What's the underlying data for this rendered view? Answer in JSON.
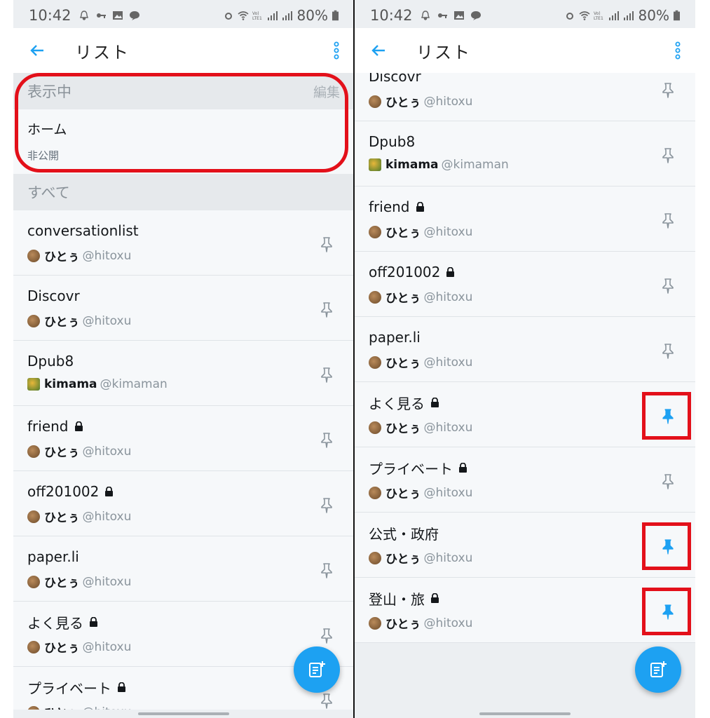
{
  "status": {
    "time": "10:42",
    "battery": "80%",
    "left_icons": [
      "notification-bell-icon",
      "key-icon",
      "image-icon",
      "chat-bubble-icon"
    ],
    "right_icons": [
      "alarm-icon",
      "wifi-icon",
      "volte-icon",
      "signal-icon",
      "signal-icon",
      "battery-icon"
    ]
  },
  "appbar": {
    "title": "リスト"
  },
  "left": {
    "visible_section": {
      "title": "表示中",
      "edit": "編集"
    },
    "home": {
      "name": "ホーム",
      "sub": "非公開"
    },
    "all_section": {
      "title": "すべて"
    },
    "lists": [
      {
        "name": "conversationlist",
        "locked": false,
        "owner": "ひとぅ",
        "handle": "@hitoxu",
        "pinned": false
      },
      {
        "name": "Discovr",
        "locked": false,
        "owner": "ひとぅ",
        "handle": "@hitoxu",
        "pinned": false
      },
      {
        "name": "Dpub8",
        "locked": false,
        "owner": "kimama",
        "handle": "@kimaman",
        "pinned": false
      },
      {
        "name": "friend",
        "locked": true,
        "owner": "ひとぅ",
        "handle": "@hitoxu",
        "pinned": false
      },
      {
        "name": "off201002",
        "locked": true,
        "owner": "ひとぅ",
        "handle": "@hitoxu",
        "pinned": false
      },
      {
        "name": "paper.li",
        "locked": false,
        "owner": "ひとぅ",
        "handle": "@hitoxu",
        "pinned": false
      },
      {
        "name": "よく見る",
        "locked": true,
        "owner": "ひとぅ",
        "handle": "@hitoxu",
        "pinned": false
      },
      {
        "name": "プライベート",
        "locked": true,
        "owner": "ひとぅ",
        "handle": "@hitoxu",
        "pinned": false
      }
    ]
  },
  "right": {
    "lists": [
      {
        "name": "Discovr",
        "locked": false,
        "owner": "ひとぅ",
        "handle": "@hitoxu",
        "pinned": false
      },
      {
        "name": "Dpub8",
        "locked": false,
        "owner": "kimama",
        "handle": "@kimaman",
        "pinned": false
      },
      {
        "name": "friend",
        "locked": true,
        "owner": "ひとぅ",
        "handle": "@hitoxu",
        "pinned": false
      },
      {
        "name": "off201002",
        "locked": true,
        "owner": "ひとぅ",
        "handle": "@hitoxu",
        "pinned": false
      },
      {
        "name": "paper.li",
        "locked": false,
        "owner": "ひとぅ",
        "handle": "@hitoxu",
        "pinned": false
      },
      {
        "name": "よく見る",
        "locked": true,
        "owner": "ひとぅ",
        "handle": "@hitoxu",
        "pinned": true
      },
      {
        "name": "プライベート",
        "locked": true,
        "owner": "ひとぅ",
        "handle": "@hitoxu",
        "pinned": false
      },
      {
        "name": "公式・政府",
        "locked": false,
        "owner": "ひとぅ",
        "handle": "@hitoxu",
        "pinned": true
      },
      {
        "name": "登山・旅",
        "locked": true,
        "owner": "ひとぅ",
        "handle": "@hitoxu",
        "pinned": true
      }
    ]
  },
  "colors": {
    "accent": "#1da1f2",
    "highlight": "#e3101a"
  }
}
